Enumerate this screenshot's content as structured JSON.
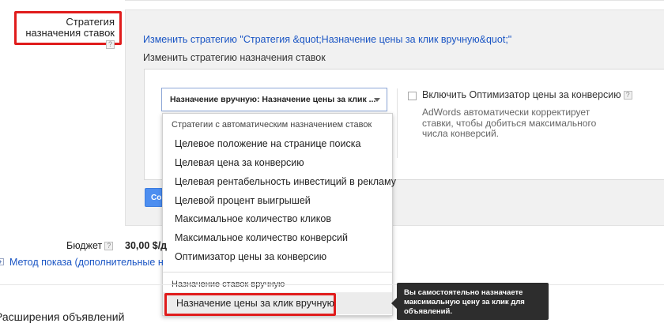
{
  "section": {
    "label": "Стратегия назначения ставок",
    "help": "?"
  },
  "strategy": {
    "change_link": "Изменить стратегию \"Стратегия &quot;Назначение цены за клик вручную&quot;\"",
    "change_subtitle": "Изменить стратегию назначения ставок",
    "select_value": "Назначение вручную: Назначение цены за клик ..."
  },
  "dropdown": {
    "group_auto": "Стратегии с автоматическим назначением ставок",
    "items": [
      "Целевое положение на странице поиска",
      "Целевая цена за конверсию",
      "Целевая рентабельность инвестиций в рекламу",
      "Целевой процент выигрышей",
      "Максимальное количество кликов",
      "Максимальное количество конверсий",
      "Оптимизатор цены за конверсию"
    ],
    "group_manual": "Назначение ставок вручную",
    "selected_item": "Назначение цены за клик вручную"
  },
  "optimizer": {
    "label": "Включить Оптимизатор цены за конверсию",
    "help": "?",
    "description": "AdWords автоматически корректирует ставки, чтобы добиться максимального числа конверсий."
  },
  "save_button": {
    "label": "Со"
  },
  "budget": {
    "label": "Бюджет",
    "help": "?",
    "value": "30,00 $/д"
  },
  "delivery": {
    "expand": "+",
    "link": "Метод показа (дополнительные н"
  },
  "extensions": {
    "title": "Расширения объявлений"
  },
  "tooltip": {
    "text": "Вы самостоятельно назначаете максимальную цену за клик для объявлений."
  }
}
